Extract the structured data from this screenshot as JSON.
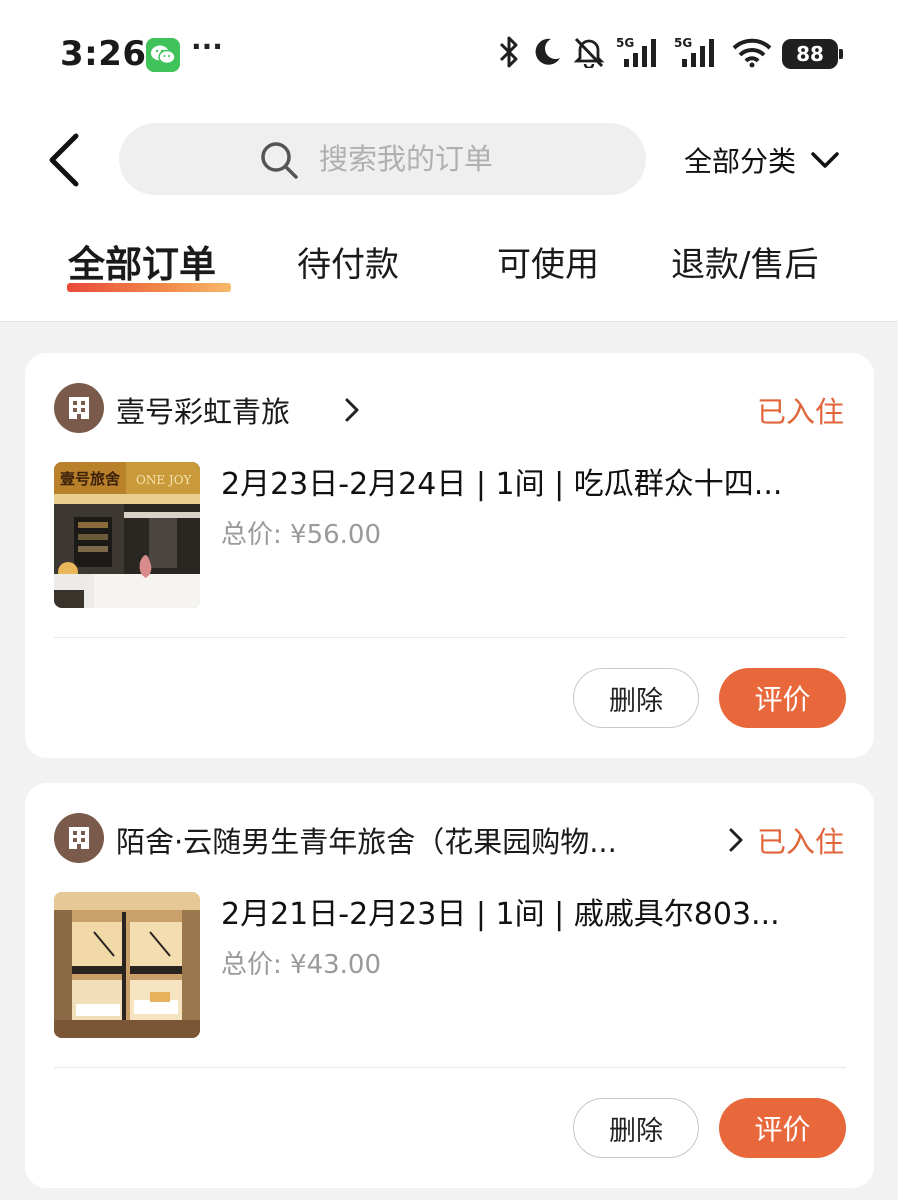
{
  "status_bar": {
    "time": "3:26",
    "battery": "88",
    "icons": [
      "wechat-icon",
      "more-dots-icon",
      "bluetooth-icon",
      "moon-icon",
      "mute-bell-icon",
      "signal-5g-icon",
      "signal-5g-icon",
      "wifi-icon",
      "battery-icon"
    ]
  },
  "header": {
    "search_placeholder": "搜索我的订单",
    "category_label": "全部分类"
  },
  "tabs": [
    {
      "label": "全部订单",
      "active": true
    },
    {
      "label": "待付款",
      "active": false
    },
    {
      "label": "可使用",
      "active": false
    },
    {
      "label": "退款/售后",
      "active": false
    }
  ],
  "orders": [
    {
      "store": "壹号彩虹青旅",
      "status": "已入住",
      "title": "2月23日-2月24日 | 1间 | 吃瓜群众十四...",
      "price": "总价: ¥56.00",
      "delete_label": "删除",
      "review_label": "评价",
      "thumb_sign": "壹号旅舍",
      "thumb_sign2": "ONE JOY"
    },
    {
      "store": "陌舍·云随男生青年旅舍（花果园购物...",
      "status": "已入住",
      "title": "2月21日-2月23日 | 1间 | 戚戚具尔803...",
      "price": "总价: ¥43.00",
      "delete_label": "删除",
      "review_label": "评价"
    }
  ],
  "colors": {
    "accent": "#e8683b",
    "status": "#e0653a",
    "background": "#f2f2f2"
  }
}
